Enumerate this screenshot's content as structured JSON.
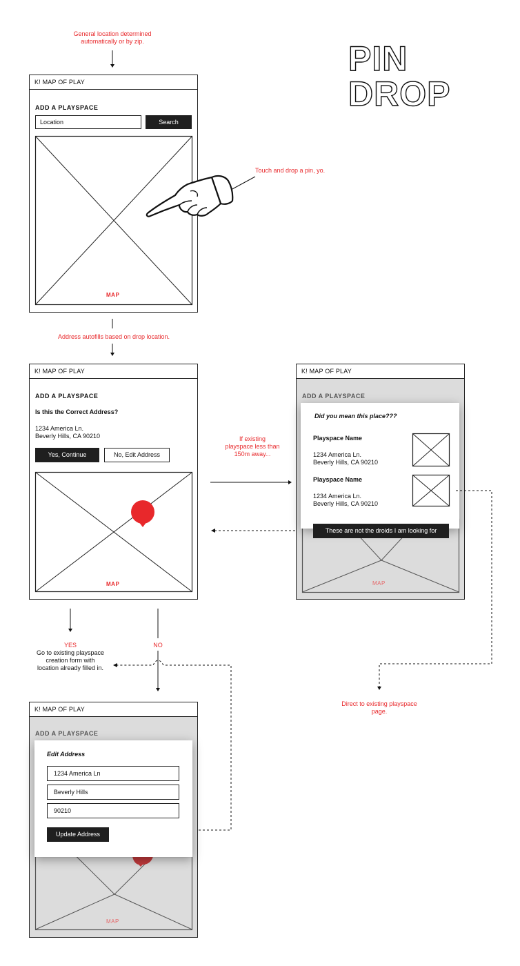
{
  "brand": {
    "title_line1": "PIN",
    "title_line2": "DROP"
  },
  "annotations": {
    "top_note": "General location determined automatically or by zip.",
    "touch_note": "Touch and drop a pin, yo.",
    "autofill_note": "Address autofills based on drop location.",
    "existing_note": "If existing playspace less than 150m away...",
    "yes_label": "YES",
    "yes_note": "Go to existing playspace creation form with location already filled in.",
    "no_label": "NO",
    "direct_note": "Direct to existing playspace page."
  },
  "screen1": {
    "header": "K! MAP OF PLAY",
    "title": "ADD A PLAYSPACE",
    "location_placeholder": "Location",
    "search_label": "Search",
    "map_label": "MAP"
  },
  "screen2": {
    "header": "K! MAP OF PLAY",
    "title": "ADD A PLAYSPACE",
    "question": "Is this the Correct Address?",
    "address_line1": "1234 America Ln.",
    "address_line2": "Beverly Hills, CA 90210",
    "yes_button": "Yes, Continue",
    "no_button": "No, Edit Address",
    "map_label": "MAP"
  },
  "screen3": {
    "header": "K! MAP OF PLAY",
    "title": "ADD A PLAYSPACE",
    "modal_title": "Did you mean this place???",
    "places": [
      {
        "name": "Playspace Name",
        "line1": "1234 America Ln.",
        "line2": "Beverly Hills, CA 90210"
      },
      {
        "name": "Playspace Name",
        "line1": "1234 America Ln.",
        "line2": "Beverly Hills, CA 90210"
      }
    ],
    "dismiss_button": "These are not the droids I am looking for",
    "map_label": "MAP"
  },
  "screen4": {
    "header": "K! MAP OF PLAY",
    "title": "ADD A PLAYSPACE",
    "modal_title": "Edit Address",
    "street_value": "1234 America Ln",
    "city_value": "Beverly Hills",
    "zip_value": "90210",
    "update_button": "Update Address",
    "map_label": "MAP"
  },
  "colors": {
    "accent": "#e8282b",
    "dark_button": "#1f1f1f",
    "overlay": "#dcdcdc"
  }
}
